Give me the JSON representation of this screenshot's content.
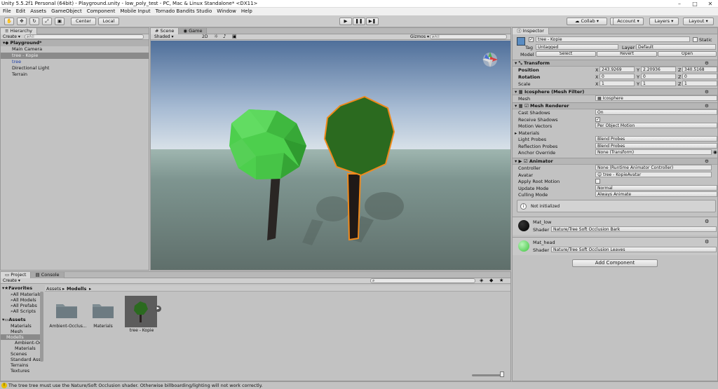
{
  "window": {
    "title": "Unity 5.5.2f1 Personal (64bit) - Playground.unity - low_poly_test - PC, Mac & Linux Standalone* <DX11>"
  },
  "menu": [
    "File",
    "Edit",
    "Assets",
    "GameObject",
    "Component",
    "Mobile Input",
    "Tornado Bandits Studio",
    "Window",
    "Help"
  ],
  "toolbar": {
    "pivot": "Center",
    "space": "Local",
    "collab": "Collab",
    "account": "Account",
    "layers": "Layers",
    "layout": "Layout"
  },
  "hierarchy": {
    "tab": "Hierarchy",
    "create": "Create",
    "search_placeholder": "All",
    "scene": "Playground*",
    "items": [
      "Main Camera",
      "tree - Kopie",
      "tree",
      "Directional Light",
      "Terrain"
    ]
  },
  "scene": {
    "tabs": [
      "Scene",
      "Game"
    ],
    "shading": "Shaded",
    "mode2d": "2D",
    "gizmos": "Gizmos",
    "search_placeholder": "All"
  },
  "project": {
    "tabs": [
      "Project",
      "Console"
    ],
    "create": "Create",
    "favorites_label": "Favorites",
    "favorites": [
      "All Materials",
      "All Models",
      "All Prefabs",
      "All Scripts"
    ],
    "assets_label": "Assets",
    "tree": [
      "Materials",
      "Mesh",
      "Modells",
      "Ambient-Occlusion",
      "Materials",
      "Scenes",
      "Standard Assets",
      "Terrains",
      "Textures"
    ],
    "breadcrumb": [
      "Assets",
      "Modells"
    ],
    "files": [
      "Ambient-Occlus...",
      "Materials",
      "tree - Kopie"
    ]
  },
  "status": {
    "message": "The tree tree must use the Nature/Soft Occlusion shader. Otherwise billboarding/lighting will not work correctly."
  },
  "inspector": {
    "tab": "Inspector",
    "name": "tree - Kopie",
    "static": "Static",
    "tag_label": "Tag",
    "tag": "Untagged",
    "layer_label": "Layer",
    "layer": "Default",
    "model_label": "Model",
    "select": "Select",
    "revert": "Revert",
    "open": "Open",
    "transform": {
      "title": "Transform",
      "position_label": "Position",
      "rotation_label": "Rotation",
      "scale_label": "Scale",
      "position": [
        "243.9269",
        "2.20936",
        "340.5168"
      ],
      "rotation": [
        "0",
        "0",
        "0"
      ],
      "scale": [
        "1",
        "1",
        "1"
      ]
    },
    "mesh_filter": {
      "title": "Icosphere (Mesh Filter)",
      "mesh_label": "Mesh",
      "mesh": "Icosphere"
    },
    "mesh_renderer": {
      "title": "Mesh Renderer",
      "rows": [
        {
          "label": "Cast Shadows",
          "value": "On"
        },
        {
          "label": "Receive Shadows",
          "value": ""
        },
        {
          "label": "Motion Vectors",
          "value": "Per Object Motion"
        },
        {
          "label": "Materials",
          "value": ""
        },
        {
          "label": "Light Probes",
          "value": "Blend Probes"
        },
        {
          "label": "Reflection Probes",
          "value": "Blend Probes"
        },
        {
          "label": "Anchor Override",
          "value": "None (Transform)"
        }
      ]
    },
    "animator": {
      "title": "Animator",
      "rows": [
        {
          "label": "Controller",
          "value": "None (Runtime Animator Controller)"
        },
        {
          "label": "Avatar",
          "value": "tree - KopieAvatar"
        },
        {
          "label": "Apply Root Motion",
          "value": ""
        },
        {
          "label": "Update Mode",
          "value": "Normal"
        },
        {
          "label": "Culling Mode",
          "value": "Always Animate"
        }
      ],
      "info": "Not initialized"
    },
    "materials": [
      {
        "name": "Mat_low",
        "shader_label": "Shader",
        "shader": "Nature/Tree Soft Occlusion Bark",
        "color": "#000000"
      },
      {
        "name": "Mat_head",
        "shader_label": "Shader",
        "shader": "Nature/Tree Soft Occlusion Leaves",
        "color": "#3ec43e"
      }
    ],
    "add_component": "Add Component"
  },
  "colors": {
    "selection_orange": "#f08a1c",
    "leaf_light": "#4fcf4f",
    "leaf_dark": "#2b6a1f",
    "trunk": "#2a2220"
  }
}
